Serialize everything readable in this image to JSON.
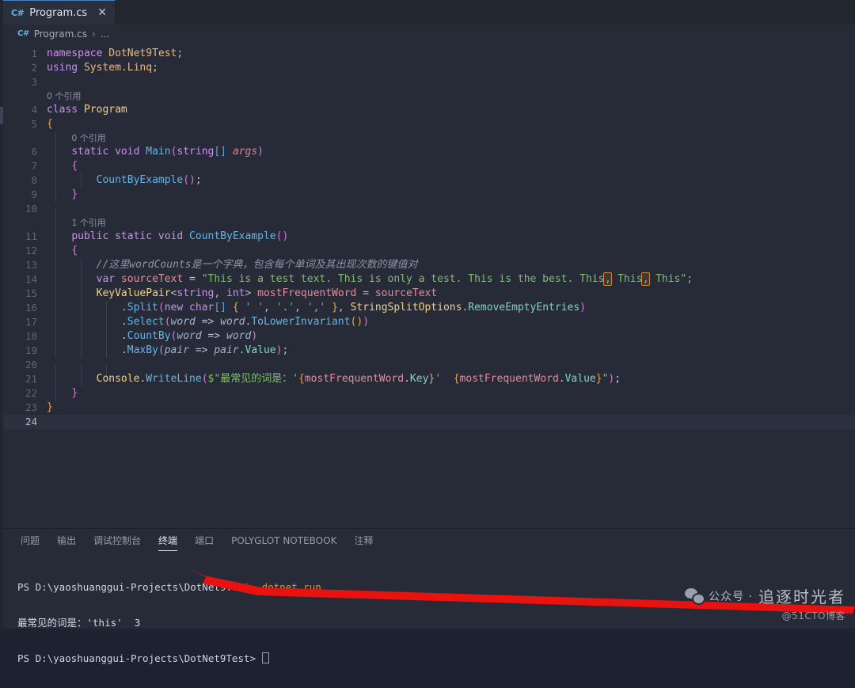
{
  "window": {
    "tab": {
      "icon": "csharp-file-icon",
      "label": "Program.cs",
      "close": "✕"
    },
    "breadcrumb": {
      "icon": "csharp-file-icon",
      "file": "Program.cs",
      "separator": "›",
      "ellipsis": "..."
    }
  },
  "editor": {
    "active_line": 24,
    "lines": [
      {
        "n": "1",
        "type": "code"
      },
      {
        "n": "2",
        "type": "code"
      },
      {
        "n": "3",
        "type": "code"
      },
      {
        "n": "",
        "type": "lens",
        "text": "0 个引用"
      },
      {
        "n": "4",
        "type": "code"
      },
      {
        "n": "5",
        "type": "code"
      },
      {
        "n": "",
        "type": "lens",
        "text": "0 个引用"
      },
      {
        "n": "6",
        "type": "code"
      },
      {
        "n": "7",
        "type": "code"
      },
      {
        "n": "8",
        "type": "code"
      },
      {
        "n": "9",
        "type": "code"
      },
      {
        "n": "10",
        "type": "code"
      },
      {
        "n": "",
        "type": "lens",
        "text": "1 个引用"
      },
      {
        "n": "11",
        "type": "code"
      },
      {
        "n": "12",
        "type": "code"
      },
      {
        "n": "13",
        "type": "code"
      },
      {
        "n": "14",
        "type": "code"
      },
      {
        "n": "15",
        "type": "code"
      },
      {
        "n": "16",
        "type": "code"
      },
      {
        "n": "17",
        "type": "code"
      },
      {
        "n": "18",
        "type": "code"
      },
      {
        "n": "19",
        "type": "code"
      },
      {
        "n": "20",
        "type": "code"
      },
      {
        "n": "21",
        "type": "code"
      },
      {
        "n": "22",
        "type": "code"
      },
      {
        "n": "23",
        "type": "code"
      },
      {
        "n": "24",
        "type": "code"
      }
    ],
    "code_text": {
      "l1": "namespace DotNet9Test;",
      "l2": "using System.Linq;",
      "l3": "",
      "lens1": "0 个引用",
      "l4": "class Program",
      "l5": "{",
      "lens2": "0 个引用",
      "l6": "    static void Main(string[] args)",
      "l7": "    {",
      "l8": "        CountByExample();",
      "l9": "    }",
      "l10": "",
      "lens3": "1 个引用",
      "l11": "    public static void CountByExample()",
      "l12": "    {",
      "l13": "        //这里wordCounts是一个字典，包含每个单词及其出现次数的键值对",
      "l14": "        var sourceText = \"This is a test text. This is only a test. This is the best. This, This, This\";",
      "l15": "        KeyValuePair<string, int> mostFrequentWord = sourceText",
      "l16": "            .Split(new char[] { ' ', '.', ',' }, StringSplitOptions.RemoveEmptyEntries)",
      "l17": "            .Select(word => word.ToLowerInvariant())",
      "l18": "            .CountBy(word => word)",
      "l19": "            .MaxBy(pair => pair.Value);",
      "l20": "",
      "l21": "        Console.WriteLine($\"最常见的词是：'{mostFrequentWord.Key}'  {mostFrequentWord.Value}\");",
      "l22": "    }",
      "l23": "}",
      "l24": ""
    },
    "tokens": {
      "namespace_kw": "namespace",
      "namespace_name": "DotNet9Test",
      "using_kw": "using",
      "using_name": "System.Linq",
      "class_kw": "class",
      "class_name": "Program",
      "static_kw": "static",
      "void_kw": "void",
      "public_kw": "public",
      "main_name": "Main",
      "string_kw": "string",
      "args_param": "args",
      "countbyexample": "CountByExample",
      "comment_l13": "//这里wordCounts是一个字典，包含每个单词及其出现次数的键值对",
      "var_kw": "var",
      "sourcetext": "sourceText",
      "string_literal_a": "\"This is a test text. This is only a test. This is the best. This",
      "string_literal_b": "This",
      "string_literal_c": "This\";",
      "comma_hl": ",",
      "keyvaluepair": "KeyValuePair",
      "int_kw": "int",
      "mostfrequentword": "mostFrequentWord",
      "split": "Split",
      "new_kw": "new",
      "char_kw": "char",
      "lit_space": "' '",
      "lit_dot": "'.'",
      "lit_comma": "','",
      "stringsplitoptions": "StringSplitOptions",
      "removeemptyentries": "RemoveEmptyEntries",
      "select": "Select",
      "word": "word",
      "tolowerinvariant": "ToLowerInvariant",
      "countby": "CountBy",
      "maxby": "MaxBy",
      "pair": "pair",
      "value": "Value",
      "key": "Key",
      "console": "Console",
      "writeline": "WriteLine",
      "interp_prefix": "$\"",
      "cn_text": "最常见的词是：",
      "quote_single": "'"
    }
  },
  "panel": {
    "tabs": [
      {
        "label": "问题",
        "active": false
      },
      {
        "label": "输出",
        "active": false
      },
      {
        "label": "调试控制台",
        "active": false
      },
      {
        "label": "终端",
        "active": true
      },
      {
        "label": "端口",
        "active": false
      },
      {
        "label": "POLYGLOT NOTEBOOK",
        "active": false
      },
      {
        "label": "注释",
        "active": false
      }
    ],
    "terminal": {
      "prompt1_path": "PS D:\\yaoshuanggui-Projects\\DotNet9Test> ",
      "prompt1_cmd": "dotnet run",
      "output_line": "最常见的词是：'this'  3",
      "prompt2_path": "PS D:\\yaoshuanggui-Projects\\DotNet9Test> "
    }
  },
  "annotation": {
    "arrow_color": "#e8120f",
    "arrow_name": "red-pointer-arrow"
  },
  "watermark": {
    "icon": "wechat-chat-icon",
    "prefix": "公众号 ·",
    "main": "追逐时光者",
    "sub": "@51CTO博客"
  },
  "theme": {
    "bg": "#272b38",
    "tabbar_bg": "#22262f",
    "accent": "#4a82c4",
    "string_green": "#7fbf6a",
    "keyword_purple": "#c792ea",
    "method_blue": "#64b5e8",
    "comment_gray": "#8c94a6"
  }
}
